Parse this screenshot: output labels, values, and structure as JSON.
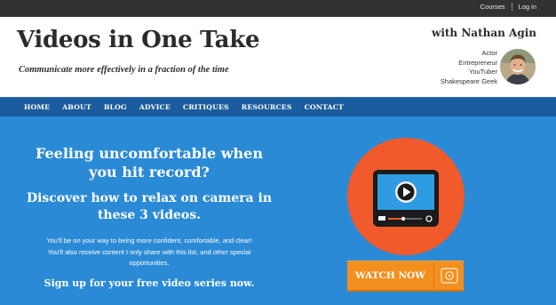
{
  "topbar": {
    "links": [
      {
        "label": "Courses"
      },
      {
        "label": "Log in"
      }
    ]
  },
  "header": {
    "site_title": "Videos in One Take",
    "tagline": "Communicate more effectively in a fraction of the time",
    "author_name": "with Nathan Agin",
    "roles": [
      "Actor",
      "Entrepreneur",
      "YouTuber",
      "Shakespeare Geek"
    ]
  },
  "nav": {
    "items": [
      {
        "label": "HOME"
      },
      {
        "label": "ABOUT"
      },
      {
        "label": "BLOG"
      },
      {
        "label": "ADVICE"
      },
      {
        "label": "CRITIQUES"
      },
      {
        "label": "RESOURCES"
      },
      {
        "label": "CONTACT"
      }
    ]
  },
  "hero": {
    "heading_lines": [
      "Feeling uncomfortable when",
      "you hit record?"
    ],
    "subheading_lines": [
      "Discover how to relax on camera in",
      "these 3 videos."
    ],
    "body_lines": [
      "You'll be on your way to being more confident, comfortable, and clear!",
      "You'll also receive content I only share with this list, and other special",
      "opportunities."
    ],
    "cta_text": "Sign up for your free video series now.",
    "button_label": "WATCH NOW"
  },
  "colors": {
    "topbar": "#323232",
    "nav": "#1a5c9e",
    "hero": "#2b8ad6",
    "circle": "#f15a2b",
    "button": "#f28f1e",
    "player_screen": "#2f9be0"
  },
  "icons": [
    "play-icon",
    "target-icon",
    "volume-icon",
    "fullscreen-icon"
  ]
}
